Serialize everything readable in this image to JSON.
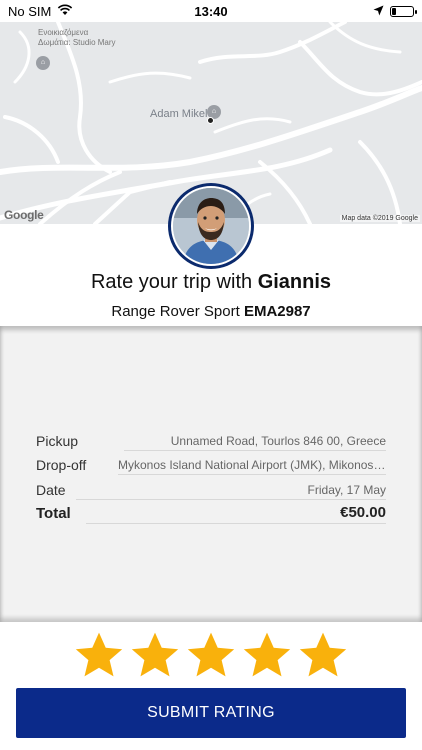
{
  "status_bar": {
    "carrier": "No SIM",
    "time": "13:40",
    "battery_level": 0.2
  },
  "map": {
    "poi_label_line1": "Ενοικιαζόμενα",
    "poi_label_line2": "Δωμάτια: Studio Mary",
    "place_label": "Adam Mikele",
    "logo": "Google",
    "attribution": "Map data ©2019 Google"
  },
  "rating": {
    "title_prefix": "Rate your trip with ",
    "driver_name": "Giannis",
    "car_model": "Range Rover Sport ",
    "plate": "EMA2987",
    "stars_selected": 5,
    "star_color": "#f9b10c"
  },
  "trip": {
    "rows": [
      {
        "label": "Pickup",
        "value": "Unnamed Road, Tourlos 846 00, Greece"
      },
      {
        "label": "Drop-off",
        "value": "Mykonos Island National Airport (JMK), Mikonos 8..."
      },
      {
        "label": "Date",
        "value": "Friday, 17 May"
      },
      {
        "label": "Total",
        "value": "€50.00"
      }
    ]
  },
  "actions": {
    "submit_label": "SUBMIT RATING"
  },
  "colors": {
    "brand_blue": "#0b2a8a"
  }
}
